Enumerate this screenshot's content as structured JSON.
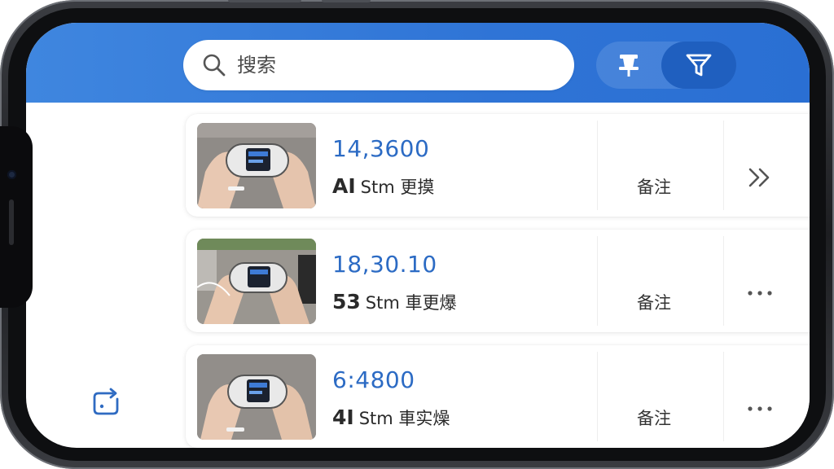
{
  "search": {
    "placeholder": "搜索",
    "value": ""
  },
  "toolbar": {
    "pin_icon": "pin-icon",
    "filter_icon": "filter-icon",
    "filter_active": true
  },
  "sidebar": {
    "action_icon": "refresh-square-icon"
  },
  "colors": {
    "header": "#2f74d6",
    "accent_text": "#2c6bc4",
    "filter_button": "#1f5fbf"
  },
  "items": [
    {
      "title": "14,3600",
      "count": "AI",
      "subtitle": "Stm 更摸",
      "note": "备注",
      "action": "»",
      "action_icon": "double-chevron-right-icon"
    },
    {
      "title": "18,30.10",
      "count": "53",
      "subtitle": "Stm 車更爆",
      "note": "备注",
      "action": "···",
      "action_icon": "more-horizontal-icon"
    },
    {
      "title": "6:4800",
      "count": "4I",
      "subtitle": "Stm 車实燥",
      "note": "备注",
      "action": "···",
      "action_icon": "more-horizontal-icon"
    }
  ]
}
